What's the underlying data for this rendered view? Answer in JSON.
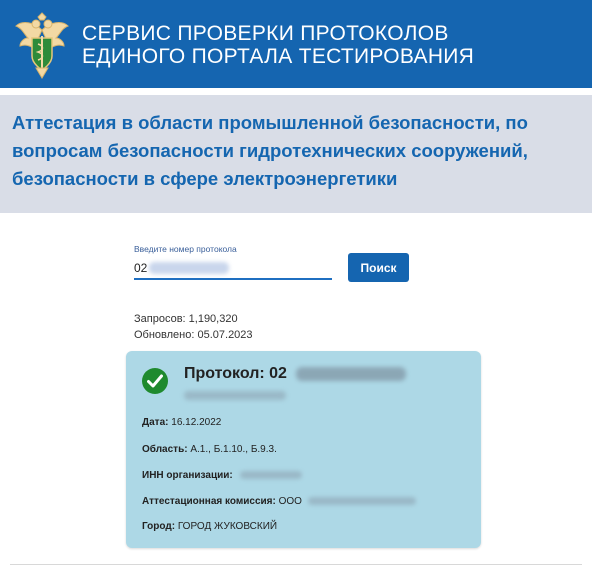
{
  "header": {
    "title_line1": "СЕРВИС ПРОВЕРКИ ПРОТОКОЛОВ",
    "title_line2": "ЕДИНОГО ПОРТАЛА ТЕСТИРОВАНИЯ",
    "logo": "emblem-icon"
  },
  "subheader": {
    "text": "Аттестация в области промышленной безопасности, по вопросам безопасности гидротехнических сооружений, безопасности в сфере электроэнергетики"
  },
  "search": {
    "label": "Введите номер протокола",
    "value": "02",
    "button_label": "Поиск"
  },
  "stats": {
    "requests": "Запросов: 1,190,320",
    "updated": "Обновлено: 05.07.2023"
  },
  "result": {
    "title": "Протокол: 02",
    "status_icon": "check-circle-icon",
    "date_label": "Дата:",
    "date_value": "16.12.2022",
    "area_label": "Область:",
    "area_value": "А.1., Б.1.10., Б.9.3.",
    "inn_label": "ИНН организации:",
    "commission_label": "Аттестационная комиссия:",
    "commission_value": "ООО",
    "city_label": "Город:",
    "city_value": "ГОРОД ЖУКОВСКИЙ"
  },
  "colors": {
    "header_bg": "#1565b0",
    "subheader_bg": "#d9dde7",
    "accent_text": "#1566b0",
    "card_bg": "#add8e6",
    "success": "#1f8a2e"
  }
}
